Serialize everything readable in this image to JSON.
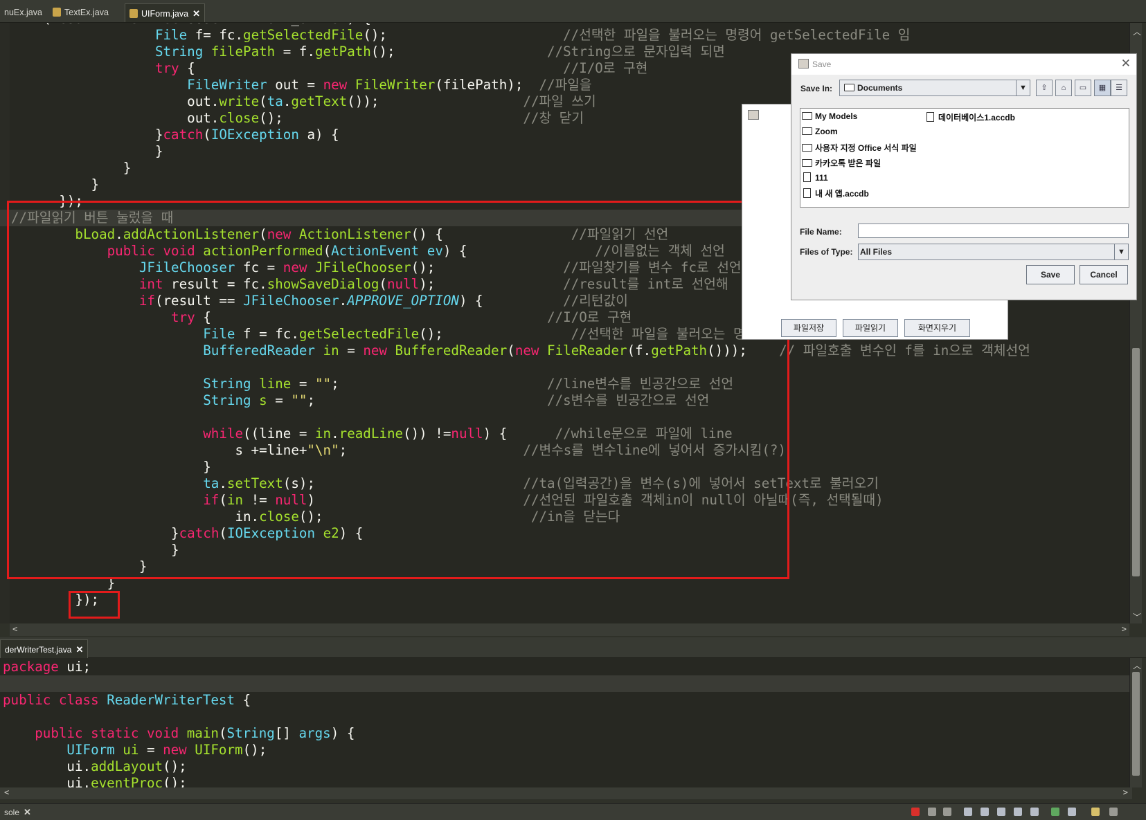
{
  "top_tabs": [
    {
      "label": "nuEx.java"
    },
    {
      "label": "TextEx.java"
    },
    {
      "label": "UIForm.java"
    }
  ],
  "bottom_tab": {
    "label": "derWriterTest.java"
  },
  "console_tab": {
    "label": "sole"
  },
  "code_top": [
    [
      [
        "  ",
        "p"
      ],
      [
        "if(result == JFileChooser.APPROVE_OPTION) {",
        "p"
      ]
    ],
    [
      [
        "                  ",
        "p"
      ],
      [
        "File",
        "t"
      ],
      [
        " f= fc.",
        "p"
      ],
      [
        "getSelectedFile",
        "f"
      ],
      [
        "();",
        "p"
      ],
      [
        "                      ",
        "p"
      ],
      [
        "//선택한 파일을 불러오는 명령어 getSelectedFile 임",
        "c"
      ]
    ],
    [
      [
        "                  ",
        "p"
      ],
      [
        "String",
        "t"
      ],
      [
        " ",
        "p"
      ],
      [
        "filePath",
        "f"
      ],
      [
        " = f.",
        "p"
      ],
      [
        "getPath",
        "f"
      ],
      [
        "();",
        "p"
      ],
      [
        "                   ",
        "p"
      ],
      [
        "//String으로 문자입력 되면",
        "c"
      ]
    ],
    [
      [
        "                  ",
        "p"
      ],
      [
        "try",
        "k"
      ],
      [
        " {",
        "p"
      ],
      [
        "                                              ",
        "p"
      ],
      [
        "//I/O로 구현",
        "c"
      ]
    ],
    [
      [
        "                      ",
        "p"
      ],
      [
        "FileWriter",
        "t"
      ],
      [
        " out = ",
        "p"
      ],
      [
        "new",
        "k"
      ],
      [
        " ",
        "p"
      ],
      [
        "FileWriter",
        "f"
      ],
      [
        "(filePath);",
        "p"
      ],
      [
        "  ",
        "p"
      ],
      [
        "//파일을",
        "c"
      ]
    ],
    [
      [
        "                      ",
        "p"
      ],
      [
        "out.",
        "p"
      ],
      [
        "write",
        "f"
      ],
      [
        "(",
        "p"
      ],
      [
        "ta",
        "t"
      ],
      [
        ".",
        "p"
      ],
      [
        "getText",
        "f"
      ],
      [
        "());",
        "p"
      ],
      [
        "                  ",
        "p"
      ],
      [
        "//파일 쓰기",
        "c"
      ]
    ],
    [
      [
        "                      ",
        "p"
      ],
      [
        "out.",
        "p"
      ],
      [
        "close",
        "f"
      ],
      [
        "();",
        "p"
      ],
      [
        "                              ",
        "p"
      ],
      [
        "//창 닫기",
        "c"
      ]
    ],
    [
      [
        "                  ",
        "p"
      ],
      [
        "}",
        "p"
      ],
      [
        "catch",
        "k"
      ],
      [
        "(",
        "p"
      ],
      [
        "IOException",
        "t"
      ],
      [
        " a) {",
        "p"
      ]
    ],
    [
      [
        "                  ",
        "p"
      ],
      [
        "}",
        "p"
      ]
    ],
    [
      [
        "              ",
        "p"
      ],
      [
        "}",
        "p"
      ]
    ],
    [
      [
        "          ",
        "p"
      ],
      [
        "}",
        "p"
      ]
    ],
    [
      [
        "      ",
        "p"
      ],
      [
        "});",
        "p"
      ]
    ],
    [
      [
        "",
        "p"
      ],
      [
        "//파일읽기 버튼 눌렀을 때",
        "c"
      ]
    ],
    [
      [
        "        ",
        "p"
      ],
      [
        "bLoad",
        "f"
      ],
      [
        ".",
        "p"
      ],
      [
        "addActionListener",
        "f"
      ],
      [
        "(",
        "p"
      ],
      [
        "new",
        "k"
      ],
      [
        " ",
        "p"
      ],
      [
        "ActionListener",
        "f"
      ],
      [
        "() {",
        "p"
      ],
      [
        "                ",
        "p"
      ],
      [
        "//파일읽기 선언",
        "c"
      ]
    ],
    [
      [
        "            ",
        "p"
      ],
      [
        "public",
        "k"
      ],
      [
        " ",
        "p"
      ],
      [
        "void",
        "k"
      ],
      [
        " ",
        "p"
      ],
      [
        "actionPerformed",
        "f"
      ],
      [
        "(",
        "p"
      ],
      [
        "ActionEvent",
        "t"
      ],
      [
        " ",
        "p"
      ],
      [
        "ev",
        "t"
      ],
      [
        ") {",
        "p"
      ],
      [
        "                ",
        "p"
      ],
      [
        "//이름없는 객체 선언",
        "c"
      ]
    ],
    [
      [
        "                ",
        "p"
      ],
      [
        "JFileChooser",
        "t"
      ],
      [
        " fc = ",
        "p"
      ],
      [
        "new",
        "k"
      ],
      [
        " ",
        "p"
      ],
      [
        "JFileChooser",
        "f"
      ],
      [
        "();",
        "p"
      ],
      [
        "                ",
        "p"
      ],
      [
        "//파일찾기를 변수 fc로 선언",
        "c"
      ]
    ],
    [
      [
        "                ",
        "p"
      ],
      [
        "int",
        "k"
      ],
      [
        " result = fc.",
        "p"
      ],
      [
        "showSaveDialog",
        "f"
      ],
      [
        "(",
        "p"
      ],
      [
        "null",
        "k"
      ],
      [
        ");",
        "p"
      ],
      [
        "                ",
        "p"
      ],
      [
        "//result를 int로 선언해",
        "c"
      ]
    ],
    [
      [
        "                ",
        "p"
      ],
      [
        "if",
        "k"
      ],
      [
        "(result == ",
        "p"
      ],
      [
        "JFileChooser",
        "t"
      ],
      [
        ".",
        "p"
      ],
      [
        "APPROVE_OPTION",
        "it"
      ],
      [
        ") {",
        "p"
      ],
      [
        "          ",
        "p"
      ],
      [
        "//리턴값이",
        "c"
      ]
    ],
    [
      [
        "                    ",
        "p"
      ],
      [
        "try",
        "k"
      ],
      [
        " {",
        "p"
      ],
      [
        "                                          ",
        "p"
      ],
      [
        "//I/O로 구현",
        "c"
      ]
    ],
    [
      [
        "                        ",
        "p"
      ],
      [
        "File",
        "t"
      ],
      [
        " f = fc.",
        "p"
      ],
      [
        "getSelectedFile",
        "f"
      ],
      [
        "();",
        "p"
      ],
      [
        "                ",
        "p"
      ],
      [
        "//선택한 파일을 불러오는 명",
        "c"
      ]
    ],
    [
      [
        "                        ",
        "p"
      ],
      [
        "BufferedReader",
        "t"
      ],
      [
        " ",
        "p"
      ],
      [
        "in",
        "f"
      ],
      [
        " = ",
        "p"
      ],
      [
        "new",
        "k"
      ],
      [
        " ",
        "p"
      ],
      [
        "BufferedReader",
        "f"
      ],
      [
        "(",
        "p"
      ],
      [
        "new",
        "k"
      ],
      [
        " ",
        "p"
      ],
      [
        "FileReader",
        "f"
      ],
      [
        "(f.",
        "p"
      ],
      [
        "getPath",
        "f"
      ],
      [
        "()));",
        "p"
      ],
      [
        "    ",
        "p"
      ],
      [
        "// 파일호출 변수인 f를 in으로 객체선언",
        "c"
      ]
    ],
    [
      [
        "",
        "p"
      ]
    ],
    [
      [
        "                        ",
        "p"
      ],
      [
        "String",
        "t"
      ],
      [
        " ",
        "p"
      ],
      [
        "line",
        "f"
      ],
      [
        " = ",
        "p"
      ],
      [
        "\"\"",
        "s"
      ],
      [
        ";",
        "p"
      ],
      [
        "                          ",
        "p"
      ],
      [
        "//line변수를 빈공간으로 선언",
        "c"
      ]
    ],
    [
      [
        "                        ",
        "p"
      ],
      [
        "String",
        "t"
      ],
      [
        " ",
        "p"
      ],
      [
        "s",
        "f"
      ],
      [
        " = ",
        "p"
      ],
      [
        "\"\"",
        "s"
      ],
      [
        ";",
        "p"
      ],
      [
        "                             ",
        "p"
      ],
      [
        "//s변수를 빈공간으로 선언",
        "c"
      ]
    ],
    [
      [
        "",
        "p"
      ]
    ],
    [
      [
        "                        ",
        "p"
      ],
      [
        "while",
        "k"
      ],
      [
        "((line = ",
        "p"
      ],
      [
        "in",
        "f"
      ],
      [
        ".",
        "p"
      ],
      [
        "readLine",
        "f"
      ],
      [
        "()) !=",
        "p"
      ],
      [
        "null",
        "k"
      ],
      [
        ") {",
        "p"
      ],
      [
        "      ",
        "p"
      ],
      [
        "//while문으로 파일에 line",
        "c"
      ]
    ],
    [
      [
        "                            ",
        "p"
      ],
      [
        "s +=line+",
        "p"
      ],
      [
        "\"\\n\"",
        "s"
      ],
      [
        ";",
        "p"
      ],
      [
        "                      ",
        "p"
      ],
      [
        "//변수s를 변수line에 넣어서 증가시킴(?)",
        "c"
      ]
    ],
    [
      [
        "                        ",
        "p"
      ],
      [
        "}",
        "p"
      ]
    ],
    [
      [
        "                        ",
        "p"
      ],
      [
        "ta",
        "t"
      ],
      [
        ".",
        "p"
      ],
      [
        "setText",
        "f"
      ],
      [
        "(s);",
        "p"
      ],
      [
        "                          ",
        "p"
      ],
      [
        "//ta(입력공간)을 변수(s)에 넣어서 setText로 불러오기",
        "c"
      ]
    ],
    [
      [
        "                        ",
        "p"
      ],
      [
        "if",
        "k"
      ],
      [
        "(",
        "p"
      ],
      [
        "in",
        "f"
      ],
      [
        " != ",
        "p"
      ],
      [
        "null",
        "k"
      ],
      [
        ")",
        "p"
      ],
      [
        "                          ",
        "p"
      ],
      [
        "//선언된 파일호출 객체in이 null이 아닐때(즉, 선택될때)",
        "c"
      ]
    ],
    [
      [
        "                            ",
        "p"
      ],
      [
        "in.",
        "p"
      ],
      [
        "close",
        "f"
      ],
      [
        "();",
        "p"
      ],
      [
        "                          ",
        "p"
      ],
      [
        "//in을 닫는다",
        "c"
      ]
    ],
    [
      [
        "                    ",
        "p"
      ],
      [
        "}",
        "p"
      ],
      [
        "catch",
        "k"
      ],
      [
        "(",
        "p"
      ],
      [
        "IOException",
        "t"
      ],
      [
        " ",
        "p"
      ],
      [
        "e2",
        "f"
      ],
      [
        ") {",
        "p"
      ]
    ],
    [
      [
        "                    ",
        "p"
      ],
      [
        "}",
        "p"
      ]
    ],
    [
      [
        "                ",
        "p"
      ],
      [
        "}",
        "p"
      ]
    ],
    [
      [
        "            ",
        "p"
      ],
      [
        "}",
        "p"
      ]
    ],
    [
      [
        "        ",
        "p"
      ],
      [
        "});",
        "p"
      ]
    ]
  ],
  "code_bottom": [
    [
      [
        "package",
        "k"
      ],
      [
        " ui;",
        "p"
      ]
    ],
    [
      [
        "",
        "p"
      ]
    ],
    [
      [
        "public",
        "k"
      ],
      [
        " ",
        "p"
      ],
      [
        "class",
        "k"
      ],
      [
        " ",
        "p"
      ],
      [
        "ReaderWriterTest",
        "t"
      ],
      [
        " {",
        "p"
      ]
    ],
    [
      [
        "",
        "p"
      ]
    ],
    [
      [
        "    ",
        "p"
      ],
      [
        "public",
        "k"
      ],
      [
        " ",
        "p"
      ],
      [
        "static",
        "k"
      ],
      [
        " ",
        "p"
      ],
      [
        "void",
        "k"
      ],
      [
        " ",
        "p"
      ],
      [
        "main",
        "f"
      ],
      [
        "(",
        "p"
      ],
      [
        "String",
        "t"
      ],
      [
        "[] ",
        "p"
      ],
      [
        "args",
        "t"
      ],
      [
        ") {",
        "p"
      ]
    ],
    [
      [
        "        ",
        "p"
      ],
      [
        "UIForm",
        "t"
      ],
      [
        " ",
        "p"
      ],
      [
        "ui",
        "f"
      ],
      [
        " = ",
        "p"
      ],
      [
        "new",
        "k"
      ],
      [
        " ",
        "p"
      ],
      [
        "UIForm",
        "f"
      ],
      [
        "();",
        "p"
      ]
    ],
    [
      [
        "        ",
        "p"
      ],
      [
        "ui.",
        "p"
      ],
      [
        "addLayout",
        "f"
      ],
      [
        "();",
        "p"
      ]
    ],
    [
      [
        "        ",
        "p"
      ],
      [
        "ui.",
        "p"
      ],
      [
        "eventProc",
        "f"
      ],
      [
        "();",
        "p"
      ]
    ]
  ],
  "app_window": {
    "buttons": [
      "파일저장",
      "파일읽기",
      "화면지우기"
    ]
  },
  "save_dialog": {
    "title": "Save",
    "save_in_label": "Save In:",
    "save_in_value": "Documents",
    "files_left": [
      {
        "name": "My Models",
        "type": "folder"
      },
      {
        "name": "Zoom",
        "type": "folder"
      },
      {
        "name": "사용자 지정 Office 서식 파일",
        "type": "folder"
      },
      {
        "name": "카카오톡 받은 파일",
        "type": "folder"
      },
      {
        "name": "111",
        "type": "file"
      },
      {
        "name": "내 새 앱.accdb",
        "type": "file"
      }
    ],
    "files_right": [
      {
        "name": "데이터베이스1.accdb",
        "type": "file"
      }
    ],
    "file_name_label": "File Name:",
    "file_name_value": "",
    "files_of_type_label": "Files of Type:",
    "files_of_type_value": "All Files",
    "save_button": "Save",
    "cancel_button": "Cancel"
  },
  "colors": {
    "editor_bg": "#272822",
    "keyword": "#f92672",
    "type": "#66d9ef",
    "function": "#a6e22e",
    "string": "#e6db74",
    "comment": "#8a8a80",
    "highlight_box": "#e31b1b"
  }
}
